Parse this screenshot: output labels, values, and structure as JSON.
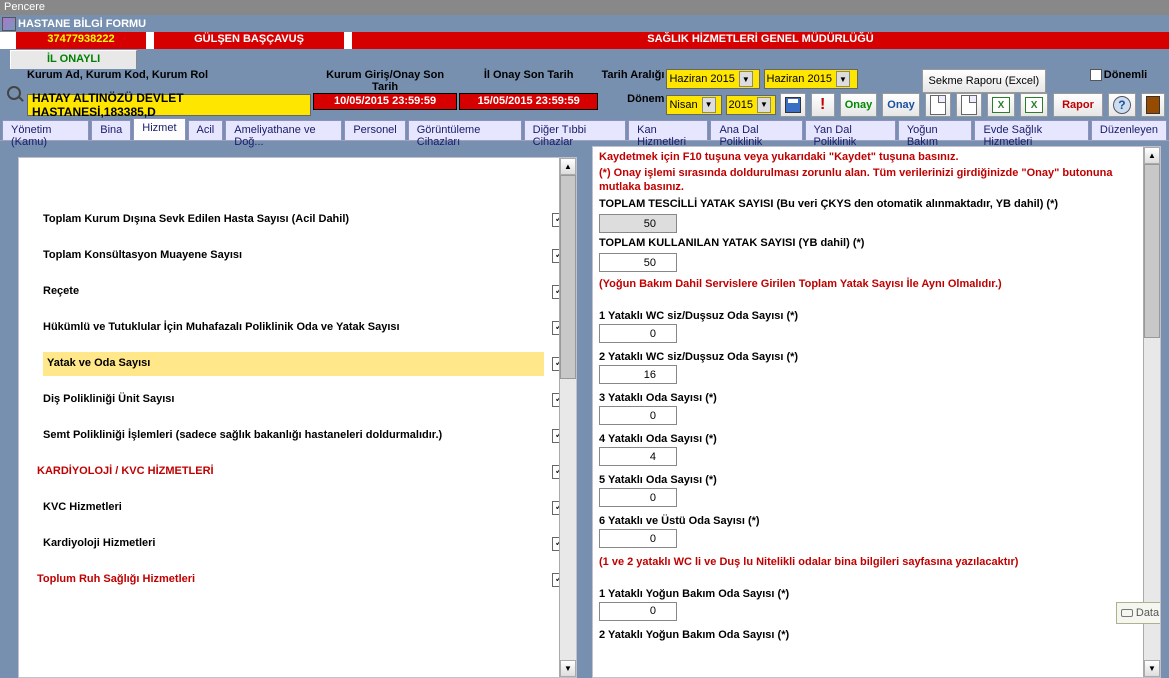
{
  "window": {
    "title": "Pencere"
  },
  "form": {
    "title": "HASTANE BİLGİ FORMU"
  },
  "red_strip": {
    "code": "37477938222",
    "person": "GÜLŞEN BAŞÇAVUŞ",
    "org": "SAĞLIK HİZMETLERİ GENEL MÜDÜRLÜĞÜ"
  },
  "status_tab": "İL ONAYLI",
  "header": {
    "left_label": "Kurum Ad, Kurum Kod, Kurum Rol",
    "search_value": "HATAY ALTINÖZÜ DEVLET HASTANESİ,183385,D",
    "kurum_label": "Kurum Giriş/Onay Son Tarih",
    "kurum_date": "10/05/2015 23:59:59",
    "ilonay_label": "İl Onay Son Tarih",
    "ilonay_date": "15/05/2015 23:59:59",
    "tarih_araligi_label": "Tarih Aralığı",
    "donem_label": "Dönem",
    "range_from": "Haziran 2015",
    "range_to": "Haziran 2015",
    "month_select": "Nisan",
    "year_select": "2015",
    "sekme_btn": "Sekme Raporu (Excel)",
    "donemli_label": "Dönemli",
    "onay": "Onay",
    "rapor": "Rapor"
  },
  "tabs": [
    "Yönetim (Kamu)",
    "Bina",
    "Hizmet",
    "Acil",
    "Ameliyathane ve Doğ...",
    "Personel",
    "Görüntüleme Cihazları",
    "Diğer Tıbbi Cihazlar",
    "Kan Hizmetleri",
    "Ana Dal Poliklinik",
    "Yan Dal Poliklinik",
    "Yoğun Bakım",
    "Evde Sağlık Hizmetleri",
    "Düzenleyen"
  ],
  "active_tab": 2,
  "left_list": {
    "i0": "Toplam Kurum Dışına Sevk Edilen Hasta Sayısı (Acil Dahil)",
    "i1": "Toplam Konsültasyon Muayene Sayısı",
    "i2": "Reçete",
    "i3": "Hükümlü ve Tutuklular İçin Muhafazalı Poliklinik Oda ve Yatak Sayısı",
    "i4": "Yatak ve Oda Sayısı",
    "i5": "Diş Polikliniği Ünit Sayısı",
    "i6": "Semt Polikliniği İşlemleri (sadece sağlık bakanlığı hastaneleri doldurmalıdır.)",
    "h1": "KARDİYOLOJİ / KVC HİZMETLERİ",
    "i7": "KVC Hizmetleri",
    "i8": "Kardiyoloji Hizmetleri",
    "h2": "Toplum Ruh Sağlığı Hizmetleri"
  },
  "right": {
    "help1": "Kaydetmek için F10 tuşuna veya yukarıdaki \"Kaydet\" tuşuna basınız.",
    "help2": "(*) Onay işlemi sırasında doldurulması zorunlu alan. Tüm verilerinizi girdiğinizde \"Onay\" butonuna mutlaka basınız.",
    "total_tescilli_lbl": "TOPLAM TESCİLLİ YATAK SAYISI (Bu veri ÇKYS den otomatik alınmaktadır, YB dahil) (*)",
    "total_tescilli_val": "50",
    "total_kullanilan_lbl": "TOPLAM KULLANILAN YATAK SAYISI (YB dahil) (*)",
    "total_kullanilan_val": "50",
    "note1": "(Yoğun Bakım Dahil Servislere Girilen Toplam Yatak Sayısı İle Aynı Olmalıdır.)",
    "f1_lbl": "1 Yataklı WC siz/Duşsuz Oda Sayısı (*)",
    "f1_val": "0",
    "f2_lbl": "2 Yataklı WC siz/Duşsuz Oda Sayısı (*)",
    "f2_val": "16",
    "f3_lbl": "3 Yataklı Oda Sayısı (*)",
    "f3_val": "0",
    "f4_lbl": "4 Yataklı Oda Sayısı (*)",
    "f4_val": "4",
    "f5_lbl": "5 Yataklı Oda Sayısı (*)",
    "f5_val": "0",
    "f6_lbl": "6 Yataklı ve Üstü Oda Sayısı (*)",
    "f6_val": "0",
    "note2": "(1 ve 2 yataklı WC li ve Duş lu Nitelikli odalar bina bilgileri sayfasına yazılacaktır)",
    "f7_lbl": "1 Yataklı Yoğun Bakım Oda Sayısı (*)",
    "f7_val": "0",
    "f8_lbl": "2 Yataklı Yoğun Bakım Oda Sayısı (*)"
  },
  "data_tip": "Data"
}
